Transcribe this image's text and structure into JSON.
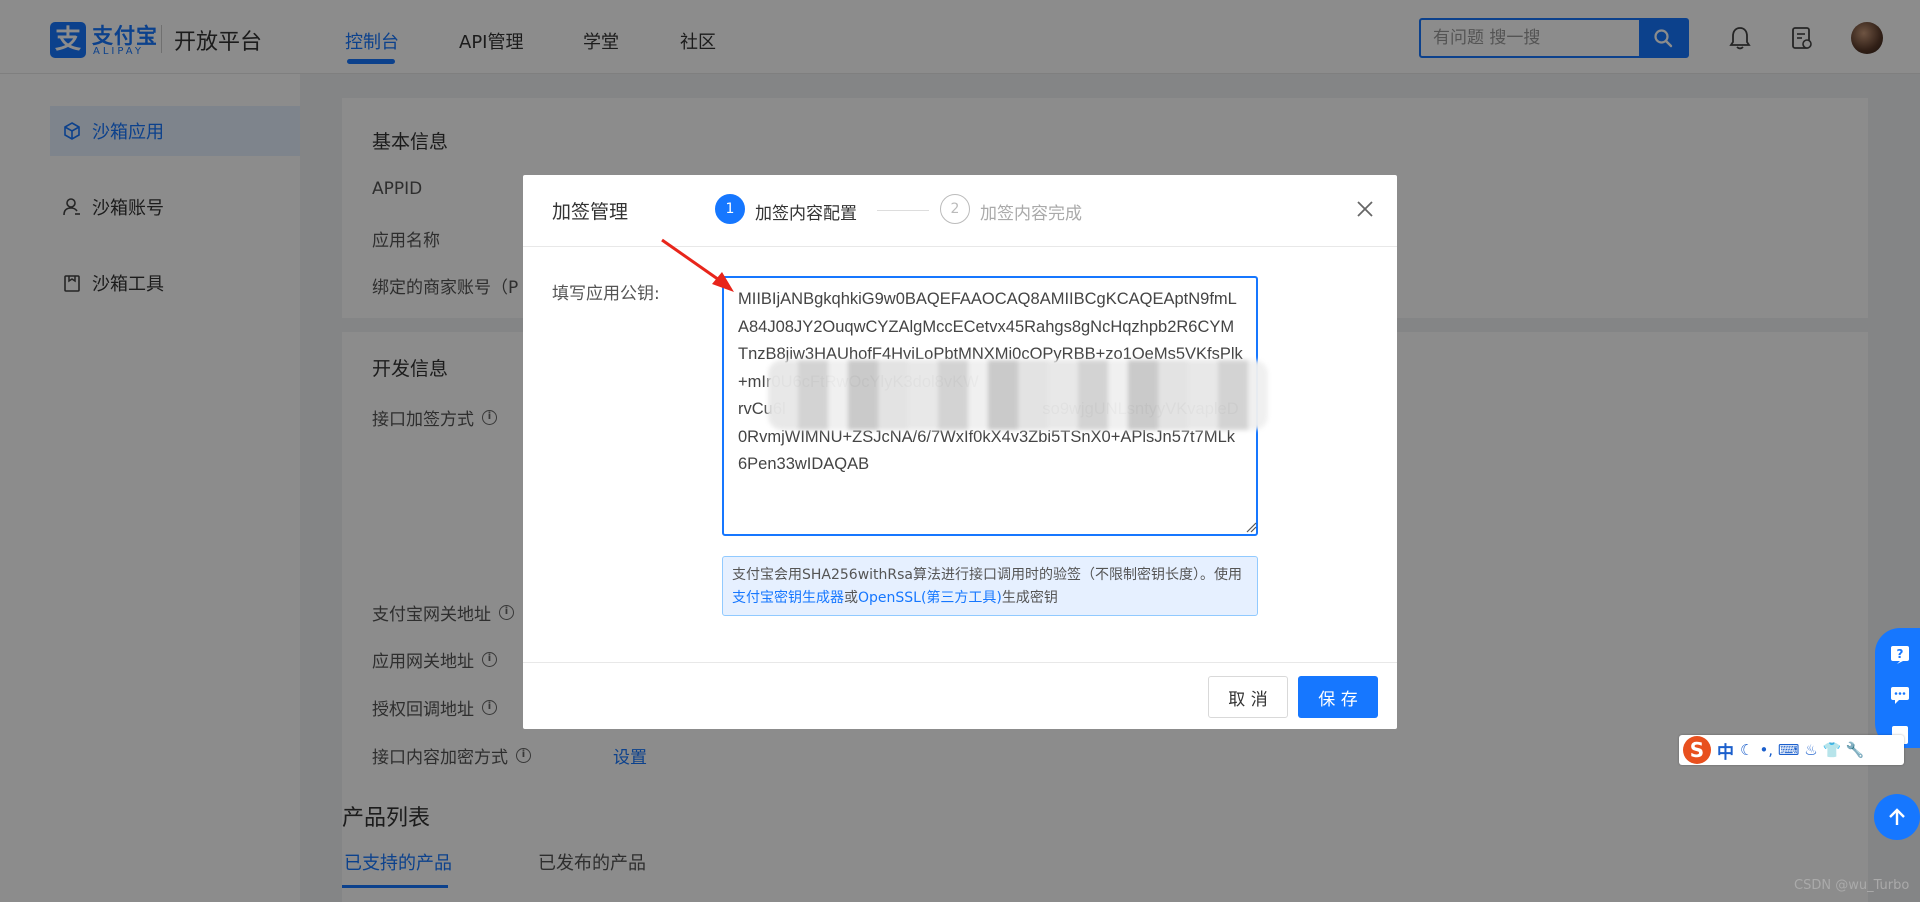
{
  "brand": {
    "logo_char": "支",
    "name_cn": "支付宝",
    "name_en": "ALIPAY",
    "platform": "开放平台"
  },
  "nav": {
    "items": [
      "控制台",
      "API管理",
      "学堂",
      "社区"
    ],
    "active_index": 0
  },
  "search": {
    "placeholder": "有问题 搜一搜",
    "value": ""
  },
  "sidebar": {
    "items": [
      {
        "label": "沙箱应用",
        "icon": "cube-icon",
        "active": true
      },
      {
        "label": "沙箱账号",
        "icon": "user-icon",
        "active": false
      },
      {
        "label": "沙箱工具",
        "icon": "clipboard-icon",
        "active": false
      }
    ]
  },
  "basic_info": {
    "title": "基本信息",
    "fields": [
      "APPID",
      "应用名称",
      "绑定的商家账号（P"
    ]
  },
  "dev_info": {
    "title": "开发信息",
    "fields": [
      "接口加签方式",
      "支付宝网关地址",
      "应用网关地址",
      "授权回调地址",
      "接口内容加密方式"
    ],
    "encrypt_link": "设置"
  },
  "products": {
    "title": "产品列表",
    "tabs": [
      "已支持的产品",
      "已发布的产品"
    ],
    "active_tab": 0
  },
  "modal": {
    "title": "加签管理",
    "steps": [
      {
        "num": "1",
        "label": "加签内容配置",
        "state": "active"
      },
      {
        "num": "2",
        "label": "加签内容完成",
        "state": "pending"
      }
    ],
    "key_label": "填写应用公钥:",
    "key_value": "MIIBIjANBgkqhkiG9w0BAQEFAAOCAQ8AMIIBCgKCAQEAptN9fmLA84J08JY2OuqwCYZAlgMccECetvx45Rahgs8gNcHqzhpb2R6CYMTnzB8jiw3HAUhofF4HviLoPbtMNXMi0cOPyRBB+zo1OeMs5VKfsPlk+mIr0U6cFtRwOcYlyK3dol8vKW                                                         rvCu6l                                                        so9wjgUNLsntyyVKvapleD0RvmjWIMNU+ZSJcNA/6/7WxIf0kX4v3Zbi5TSnX0+APlsJn57t7MLk6Pen33wIDAQAB",
    "tip_prefix": "支付宝会用SHA256withRsa算法进行接口调用时的验签（不限制密钥长度）。使用",
    "tip_link1": "支付宝密钥生成器",
    "tip_mid": "或",
    "tip_link2": "OpenSSL(第三方工具)",
    "tip_suffix": "生成密钥",
    "cancel": "取 消",
    "save": "保 存"
  },
  "ime": {
    "label": "中",
    "extra": "•, ⌨ ♨ 👕 🔧"
  },
  "watermark": "CSDN @wu_Turbo",
  "colors": {
    "accent": "#1677ff",
    "overlay": "rgba(0,0,0,0.45)"
  }
}
